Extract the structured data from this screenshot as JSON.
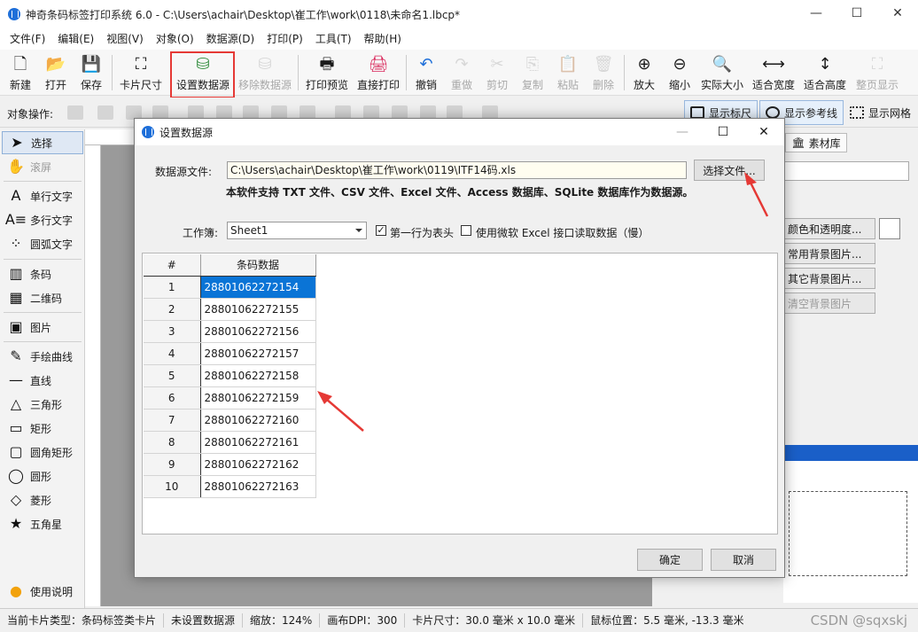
{
  "window": {
    "title": "神奇条码标签打印系统 6.0 - C:\\Users\\achair\\Desktop\\崔工作\\work\\0118\\未命名1.lbcp*",
    "minimize": "—",
    "maximize": "☐",
    "close": "✕"
  },
  "menu": [
    "文件(F)",
    "编辑(E)",
    "视图(V)",
    "对象(O)",
    "数据源(D)",
    "打印(P)",
    "工具(T)",
    "帮助(H)"
  ],
  "toolbar": {
    "new": "新建",
    "open": "打开",
    "save": "保存",
    "card_size": "卡片尺寸",
    "set_datasource": "设置数据源",
    "remove_datasource": "移除数据源",
    "print_preview": "打印预览",
    "direct_print": "直接打印",
    "undo": "撤销",
    "redo": "重做",
    "cut": "剪切",
    "copy": "复制",
    "paste": "粘贴",
    "delete": "删除",
    "zoom_in": "放大",
    "zoom_out": "缩小",
    "actual_size": "实际大小",
    "fit_width": "适合宽度",
    "fit_height": "适合高度",
    "full_page": "整页显示"
  },
  "objbar": {
    "label": "对象操作:",
    "show_ruler": "显示标尺",
    "show_guides": "显示参考线",
    "show_grid": "显示网格"
  },
  "tools": {
    "select": "选择",
    "scroll": "滚屏",
    "single_text": "单行文字",
    "multi_text": "多行文字",
    "arc_text": "圆弧文字",
    "barcode": "条码",
    "qrcode": "二维码",
    "image": "图片",
    "freehand": "手绘曲线",
    "line": "直线",
    "triangle": "三角形",
    "rect": "矩形",
    "round_rect": "圆角矩形",
    "ellipse": "圆形",
    "diamond": "菱形",
    "star": "五角星",
    "help": "使用说明"
  },
  "right_panel": {
    "tab_material": "素材库",
    "btn_color": "颜色和透明度...",
    "btn_bg_image": "常用背景图片...",
    "btn_other_bg": "其它背景图片...",
    "btn_clear_bg": "清空背景图片"
  },
  "dialog": {
    "title": "设置数据源",
    "source_label": "数据源文件:",
    "source_value": "C:\\Users\\achair\\Desktop\\崔工作\\work\\0119\\ITF14码.xls",
    "choose_file": "选择文件...",
    "note": "本软件支持 TXT 文件、CSV 文件、Excel 文件、Access 数据库、SQLite 数据库作为数据源。",
    "workbook_label": "工作簿:",
    "sheet": "Sheet1",
    "first_row_header": "第一行为表头",
    "first_row_checked": "✓",
    "use_ms_excel": "使用微软 Excel 接口读取数据（慢）",
    "grid": {
      "headers": [
        "#",
        "条码数据"
      ],
      "rows": [
        [
          "1",
          "28801062272154"
        ],
        [
          "2",
          "28801062272155"
        ],
        [
          "3",
          "28801062272156"
        ],
        [
          "4",
          "28801062272157"
        ],
        [
          "5",
          "28801062272158"
        ],
        [
          "6",
          "28801062272159"
        ],
        [
          "7",
          "28801062272160"
        ],
        [
          "8",
          "28801062272161"
        ],
        [
          "9",
          "28801062272162"
        ],
        [
          "10",
          "28801062272163"
        ]
      ]
    },
    "ok": "确定",
    "cancel": "取消"
  },
  "status": {
    "card_type": "当前卡片类型：条码标签类卡片",
    "datasource": "未设置数据源",
    "zoom": "缩放：124%",
    "dpi": "画布DPI：300",
    "card_size": "卡片尺寸：30.0 毫米 x 10.0 毫米",
    "mouse_pos": "鼠标位置：5.5 毫米, -13.3 毫米"
  },
  "watermark": "CSDN @sqxskj",
  "colors": {
    "accent": "#0a74d6",
    "highlight_red": "#e53935",
    "brand_blue": "#1e6fd9"
  }
}
